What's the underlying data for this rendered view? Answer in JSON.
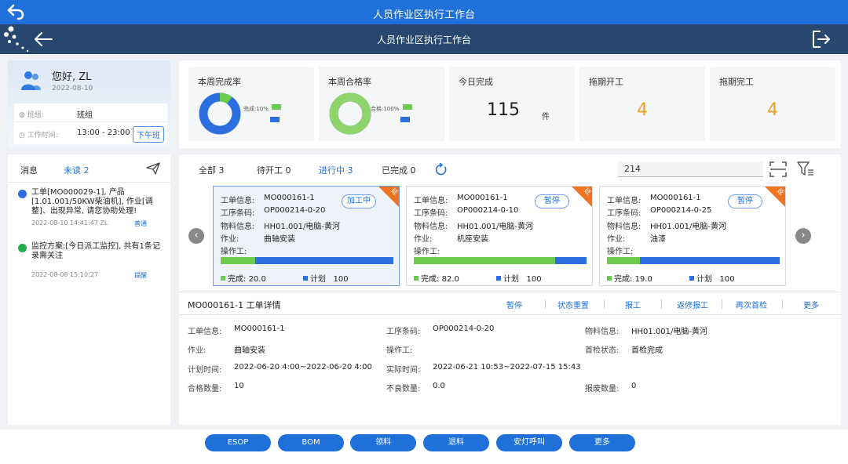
{
  "window": {
    "title": "人员作业区执行工作台"
  },
  "header": {
    "title": "人员作业区执行工作台"
  },
  "user": {
    "greeting": "您好, ZL",
    "date": "2022-08-10",
    "team_label": "班组:",
    "team_value": "班组",
    "worktime_label": "工作时间:",
    "worktime_value": "13:00 - 23:00",
    "shift_button": "下午班"
  },
  "kpis": {
    "week_completion": {
      "title": "本周完成率",
      "legend": "完成:10%",
      "fraction": 0.1
    },
    "week_pass": {
      "title": "本周合格率",
      "legend": "合格:100%",
      "fraction": 1.0
    },
    "today_done": {
      "title": "今日完成",
      "value": "115",
      "unit": "件"
    },
    "delay_start": {
      "title": "拖期开工",
      "value": "4"
    },
    "delay_finish": {
      "title": "拖期完工",
      "value": "4"
    }
  },
  "colors": {
    "primary": "#1f70d8",
    "green": "#6ccb4f",
    "orange": "#f0a020",
    "blue": "#2d6fe0"
  },
  "messages": {
    "title": "消息",
    "unread": "未读 2",
    "items": [
      {
        "text": "工单[MO000029-1], 产品[1.01.001/50KW柴油机], 作业[调整]、出现异常, 请您协助处理!",
        "time": "2022-08-10 14:41:47 ZL",
        "tag": "普通"
      },
      {
        "text": "监控方案:[今日派工监控], 共有1条记录需关注",
        "time": "2022-08-08 15:10:27",
        "tag": "提醒"
      }
    ]
  },
  "tabs": [
    {
      "label": "全部 3"
    },
    {
      "label": "待开工 0"
    },
    {
      "label": "进行中 3"
    },
    {
      "label": "已完成 0"
    }
  ],
  "search": {
    "value": "214"
  },
  "card_labels": {
    "order": "工单信息:",
    "process": "工序条码:",
    "material": "物料信息:",
    "job": "作业:",
    "operator": "操作工:",
    "done": "完成:",
    "plan": "计划",
    "corner": "延"
  },
  "cards": [
    {
      "order": "MO000161-1",
      "process": "OP000214-0-20",
      "material": "HH01.001/电脑-黄河",
      "job": "曲轴安装",
      "status": "加工中",
      "done": "20.0",
      "plan": "100",
      "progress": 0.2
    },
    {
      "order": "MO000161-1",
      "process": "OP000214-0-10",
      "material": "HH01.001/电脑-黄河",
      "job": "机座安装",
      "status": "暂停",
      "done": "82.0",
      "plan": "100",
      "progress": 0.82
    },
    {
      "order": "MO000161-1",
      "process": "OP000214-0-25",
      "material": "HH01.001/电脑-黄河",
      "job": "油漆",
      "status": "暂停",
      "done": "19.0",
      "plan": "100",
      "progress": 0.19
    }
  ],
  "detail": {
    "title": "MO000161-1 工单详情",
    "actions": [
      "暂停",
      "状态重置",
      "报工",
      "返修报工",
      "再次首检",
      "更多"
    ],
    "fields": {
      "order_label": "工单信息:",
      "order": "MO000161-1",
      "process_label": "工序条码:",
      "process": "OP000214-0-20",
      "material_label": "物料信息:",
      "material": "HH01.001/电脑-黄河",
      "job_label": "作业:",
      "job": "曲轴安装",
      "operator_label": "操作工:",
      "operator": "",
      "inspect_label": "首检状态:",
      "inspect": "首检完成",
      "plan_time_label": "计划时间:",
      "plan_time": "2022-06-20 4:00~2022-06-20 4:00",
      "actual_time_label": "实际时间:",
      "actual_time": "2022-06-21 10:53~2022-07-15 15:43",
      "pass_label": "合格数量:",
      "pass": "10",
      "bad_label": "不良数量:",
      "bad": "0.0",
      "scrap_label": "报废数量:",
      "scrap": "0"
    }
  },
  "footer": [
    "ESOP",
    "BOM",
    "领料",
    "退料",
    "安灯呼叫",
    "更多"
  ]
}
